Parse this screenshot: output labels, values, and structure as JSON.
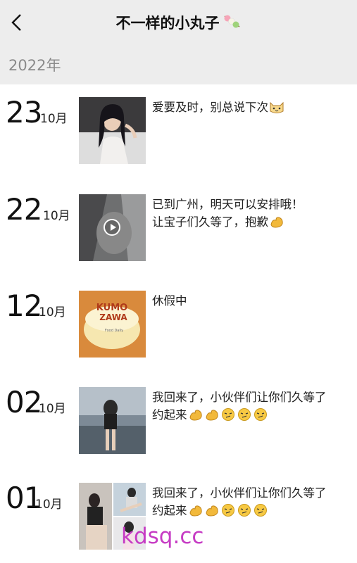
{
  "header": {
    "title": "不一样的小丸子",
    "title_emoji": "dango-icon",
    "back_icon": "chevron-left-icon"
  },
  "year_label": "2022年",
  "posts": [
    {
      "day": "23",
      "month": "10月",
      "lines": [
        "爱要及时，别总说下次"
      ],
      "emojis": [
        "cat-face-icon"
      ],
      "media": "photo"
    },
    {
      "day": "22",
      "month": "10月",
      "lines": [
        "已到广州，明天可以安排哦！",
        "让宝子们久等了，抱歉"
      ],
      "emojis": [
        "flex-arm-icon"
      ],
      "media": "video"
    },
    {
      "day": "12",
      "month": "10月",
      "lines": [
        "休假中"
      ],
      "emojis": [],
      "media": "photo",
      "photo_text": {
        "brand_line1": "KUMO",
        "brand_line2": "ZAWA",
        "small": "Food Daily"
      }
    },
    {
      "day": "02",
      "month": "10月",
      "lines": [
        "我回来了，小伙伴们让你们久等了",
        "约起来"
      ],
      "emojis": [
        "flex-arm-icon",
        "flex-arm-icon",
        "smirk-face-icon",
        "smirk-face-icon",
        "smirk-face-icon"
      ],
      "media": "photo"
    },
    {
      "day": "01",
      "month": "10月",
      "lines": [
        "我回来了，小伙伴们让你们久等了",
        "约起来"
      ],
      "emojis": [
        "flex-arm-icon",
        "flex-arm-icon",
        "smirk-face-icon",
        "smirk-face-icon",
        "smirk-face-icon"
      ],
      "media": "photo-grid"
    }
  ],
  "watermark": "kdsq.cc",
  "colors": {
    "header_bg": "#ededed",
    "watermark": "#c63cc4",
    "year_text": "#8a8a8a"
  }
}
